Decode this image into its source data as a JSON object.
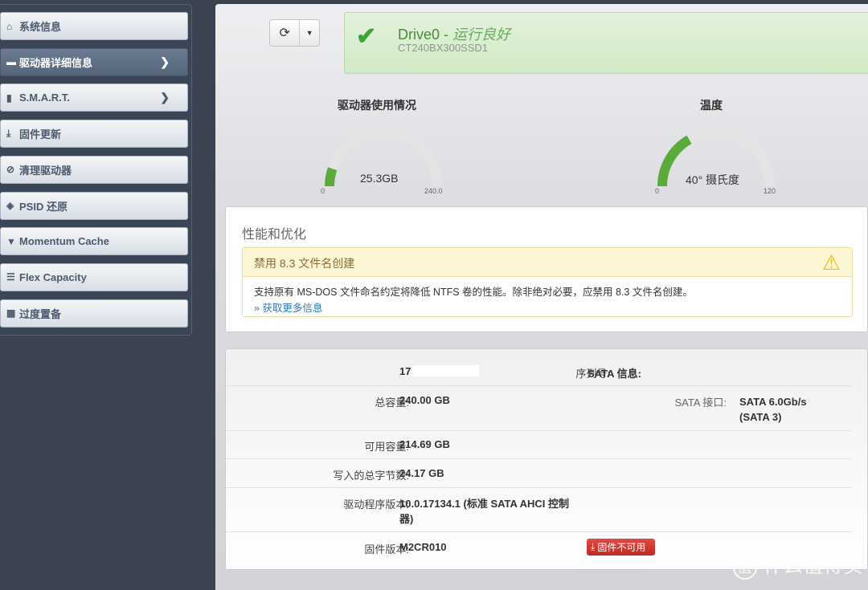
{
  "sidebar": {
    "items": [
      {
        "label": "系统信息",
        "icon": "home-icon"
      },
      {
        "label": "驱动器详细信息",
        "icon": "drive-icon",
        "active": true,
        "chevron": true
      },
      {
        "label": "S.M.A.R.T.",
        "icon": "bar-chart-icon",
        "chevron": true
      },
      {
        "label": "固件更新",
        "icon": "download-icon"
      },
      {
        "label": "清理驱动器",
        "icon": "ban-icon"
      },
      {
        "label": "PSID 还原",
        "icon": "eye-slash-icon"
      },
      {
        "label": "Momentum Cache",
        "icon": "filter-icon"
      },
      {
        "label": "Flex Capacity",
        "icon": "align-left-icon"
      },
      {
        "label": "过度置备",
        "icon": "grid-icon"
      }
    ]
  },
  "status": {
    "drive": "Drive0",
    "sep": " - ",
    "health": "运行良好",
    "model": "CT240BX300SSD1",
    "color": "#4a9a3c"
  },
  "gauges": {
    "usage": {
      "title": "驱动器使用情况",
      "value": 25.3,
      "display": "25.3GB",
      "min": "0",
      "max": "240.0",
      "max_num": 240
    },
    "temp": {
      "title": "温度",
      "value": 40,
      "display": "40° 摄氏度",
      "min": "0",
      "max": "120",
      "max_num": 120
    },
    "fill_color": "#5aaa3c"
  },
  "perf": {
    "title": "性能和优化",
    "warning_title": "禁用 8.3 文件名创建",
    "warning_body": "支持原有 MS-DOS 文件命名约定将降低 NTFS 卷的性能。除非绝对必要，应禁用 8.3 文件名创建。",
    "link": "» 获取更多信息"
  },
  "info": {
    "serial_label": "序列号:",
    "serial_value": "17",
    "capacity_label": "总容量:",
    "capacity_value": "240.00 GB",
    "available_label": "可用容量:",
    "available_value": "214.69 GB",
    "written_label": "写入的总字节数:",
    "written_value": "24.17 GB",
    "driver_label": "驱动程序版本:",
    "driver_value": "10.0.17134.1 (标准 SATA AHCI 控制器)",
    "firmware_label": "固件版本:",
    "firmware_value": "M2CR010",
    "firmware_button": "固件不可用",
    "sata_header": "SATA 信息:",
    "sata_label": "SATA 接口:",
    "sata_value": "SATA 6.0Gb/s (SATA 3)"
  },
  "watermark": "值 什么值得买"
}
